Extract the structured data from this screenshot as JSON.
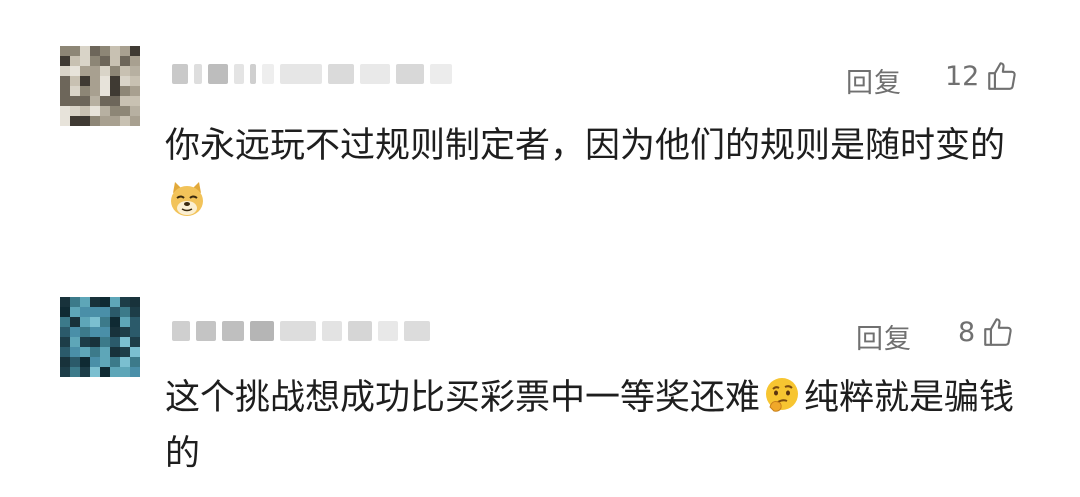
{
  "comments": [
    {
      "reply_label": "回复",
      "like_count": "12",
      "content_part1": "你永远玩不过规则制定者，因为他们的规则是随时变的",
      "content_emoji": "doge-emoji",
      "content_part2": ""
    },
    {
      "reply_label": "回复",
      "like_count": "8",
      "content_part1": "这个挑战想成功比买彩票中一等奖还难",
      "content_emoji": "thinking-emoji",
      "content_part2": "纯粹就是骗钱的"
    }
  ],
  "icons": {
    "like": "thumbs-up-icon"
  },
  "colors": {
    "meta_text": "#707070",
    "content_text": "#1e1e1e",
    "background": "#ffffff"
  }
}
